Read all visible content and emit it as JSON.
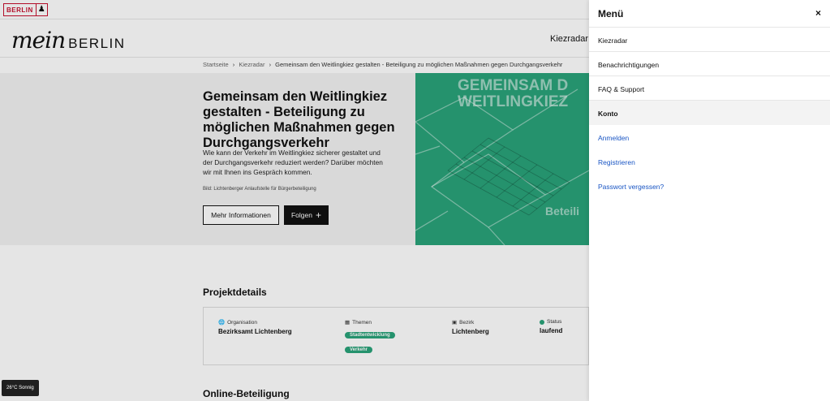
{
  "topbar": {
    "badge_text": "BERLIN",
    "badge_icon": "bear-icon"
  },
  "header": {
    "logo_script": "mein",
    "logo_word": "BERLIN",
    "nav_kiezradar": "Kiezradar"
  },
  "breadcrumb": {
    "items": [
      "Startseite",
      "Kiezradar",
      "Gemeinsam den Weitlingkiez gestalten - Beteiligung zu möglichen Maßnahmen gegen Durchgangsverkehr"
    ],
    "separator": "›"
  },
  "hero": {
    "title": "Gemeinsam den Weitlingkiez gestalten - Beteiligung zu möglichen Maßnahmen gegen Durchgangsverkehr",
    "description": "Wie kann der Verkehr im Weitlingkiez sicherer gestaltet und der Durchgangsverkehr reduziert werden? Darüber möchten wir mit Ihnen ins Gespräch kommen.",
    "credit": "Bild: Lichtenberger Anlaufstelle für Bürgerbeteiligung",
    "btn_info": "Mehr Informationen",
    "btn_follow": "Folgen",
    "image_text_line1": "GEMEINSAM D",
    "image_text_line2": "WEITLINGKIEZ",
    "image_text_small": "Beteili",
    "accent_color": "#2aa37a"
  },
  "details": {
    "title": "Projektdetails",
    "organisation_label": "Organisation",
    "organisation_value": "Bezirksamt Lichtenberg",
    "themen_label": "Themen",
    "themen_tags": [
      "Stadtentwicklung",
      "Verkehr"
    ],
    "bezirk_label": "Bezirk",
    "bezirk_value": "Lichtenberg",
    "status_label": "Status",
    "status_value": "laufend"
  },
  "online": {
    "title": "Online-Beteiligung"
  },
  "weather": {
    "text": "26°C Sonnig"
  },
  "menu": {
    "title": "Menü",
    "close": "×",
    "items": [
      "Kiezradar",
      "Benachrichtigungen",
      "FAQ & Support"
    ],
    "account_heading": "Konto",
    "account_links": [
      "Anmelden",
      "Registrieren",
      "Passwort vergessen?"
    ],
    "link_color": "#1a56c4"
  }
}
